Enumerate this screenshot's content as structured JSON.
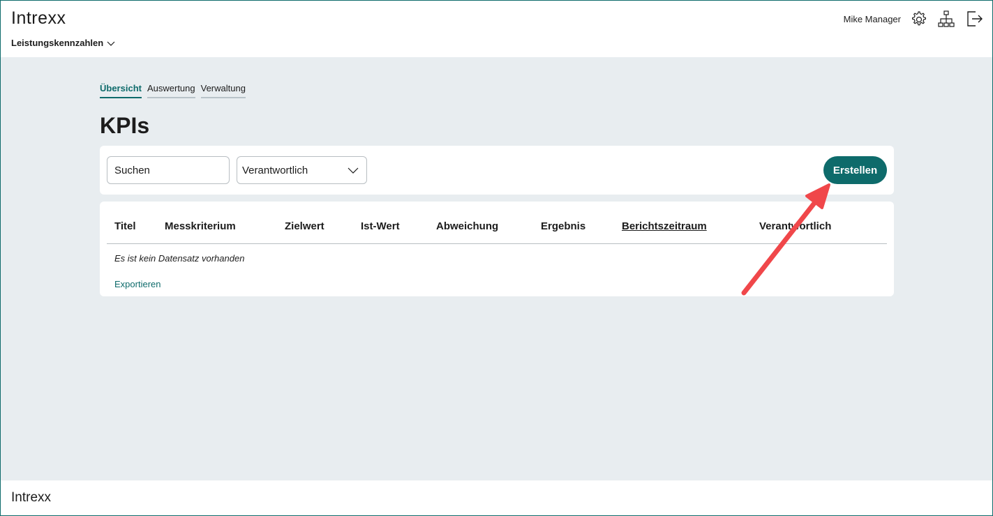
{
  "header": {
    "logo": "Intrexx",
    "app_menu_label": "Leistungskennzahlen",
    "user_name": "Mike Manager",
    "icons": [
      "gear-icon",
      "sitemap-icon",
      "logout-icon"
    ]
  },
  "tabs": [
    {
      "label": "Übersicht",
      "active": true
    },
    {
      "label": "Auswertung",
      "active": false
    },
    {
      "label": "Verwaltung",
      "active": false
    }
  ],
  "page_title": "KPIs",
  "toolbar": {
    "search_placeholder": "Suchen",
    "responsible_select": "Verantwortlich",
    "create_label": "Erstellen"
  },
  "table": {
    "columns": [
      "Titel",
      "Messkriterium",
      "Zielwert",
      "Ist-Wert",
      "Abweichung",
      "Ergebnis",
      "Berichtszeitraum",
      "Verantwortlich"
    ],
    "empty_message": "Es ist kein Datensatz vorhanden",
    "export_label": "Exportieren"
  },
  "footer": {
    "logo": "Intrexx"
  },
  "colors": {
    "accent": "#0e6b6b",
    "background": "#e8edf0",
    "annotation_arrow": "#f0474a"
  }
}
